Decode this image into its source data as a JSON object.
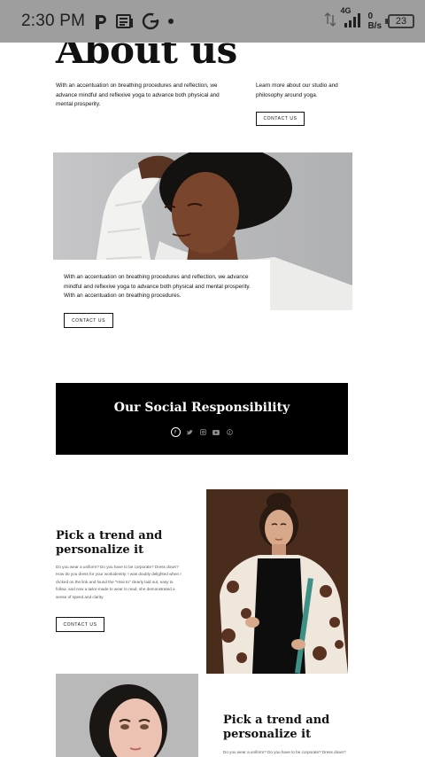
{
  "status_bar": {
    "time": "2:30 PM",
    "network_type": "4G",
    "speed_value": "0",
    "speed_unit": "B/s",
    "battery": "23"
  },
  "about": {
    "title": "About us",
    "description": "With an accentuation on breathing procedures and reflection, we advance mindful and reflexive yoga to advance both physical and mental prosperity.",
    "learn_more": "Learn more about our studio and philosophy around yoga.",
    "button_label": "CONTACT US"
  },
  "hero": {
    "text": "With an accentuation on breathing procedures and reflection, we advance mindful and reflexive yoga to advance both physical and mental prosperity. With an accentuation on breathing procedures.",
    "button_label": "CONTACT US"
  },
  "social": {
    "title": "Our Social Responsibility",
    "icons": [
      "facebook-icon",
      "twitter-icon",
      "instagram-icon",
      "youtube-icon",
      "pinterest-icon"
    ]
  },
  "trend_1": {
    "title": "Pick a trend and personalize it",
    "body": "Do you wear a uniform? Do you have to be corporate? Dress down? How do you dress for your workidentity. I was doubly delighted when I clicked on the link and found the \"How to\" clearly laid out, easy to follow, and now a tailor-made to wear to read, she demonstrated a sense of speed and clarity.",
    "button_label": "CONTACT US"
  },
  "trend_2": {
    "title": "Pick a trend and personalize it",
    "body": "Do you wear a uniform? Do you have to be corporate? Dress down? How"
  },
  "colors": {
    "status_bar_bg": "#9e9e9e",
    "social_bg": "#000000",
    "hero_bg": "#bcbdbf",
    "photo1_bg": "#4a2c1c"
  }
}
